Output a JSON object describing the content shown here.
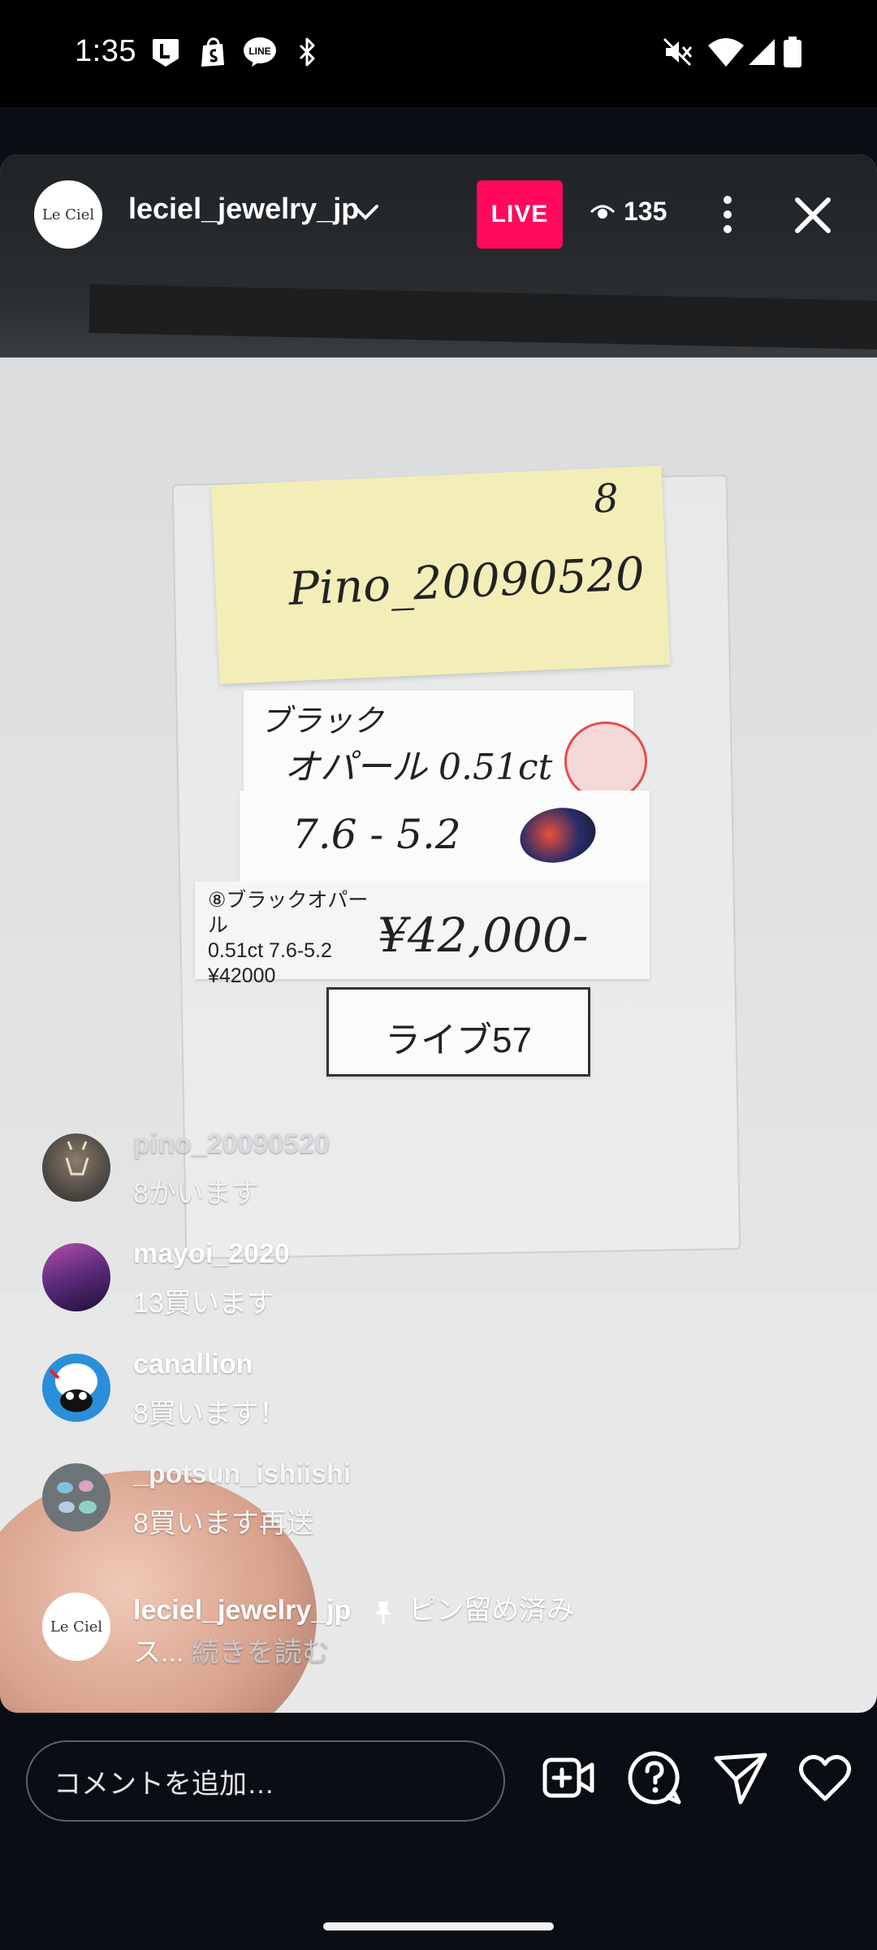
{
  "status_bar": {
    "time": "1:35",
    "icons": [
      "line-l-icon",
      "shopify-icon",
      "line-chat-icon",
      "bluetooth-icon",
      "mute-icon",
      "wifi-icon",
      "signal-icon",
      "battery-icon"
    ]
  },
  "header": {
    "username": "leciel_jewelry_jp",
    "avatar_text": "Le Ciel",
    "live_label": "LIVE",
    "viewer_count": "135"
  },
  "video_content": {
    "note_number": "8",
    "note_name": "Pino_20090520",
    "card_line1": "ブラック",
    "card_line2": "オパール 0.51ct",
    "card_size": "7.6 - 5.2",
    "tag_line1": "⑧ブラックオパール",
    "tag_line2": "0.51ct 7.6-5.2",
    "tag_line3": "¥42000",
    "price_hand": "¥42,000-",
    "live_label_card": "ライブ57"
  },
  "comments": [
    {
      "user": "pino_20090520",
      "text": "8かいます"
    },
    {
      "user": "mayoi_2020",
      "text": "13買います"
    },
    {
      "user": "canallion",
      "text": "8買います！"
    },
    {
      "user": "_potsun_ishiishi",
      "text": "8買います再送"
    }
  ],
  "pinned": {
    "user": "leciel_jewelry_jp",
    "pin_label": "ピン留め済み",
    "text_start": "ス...",
    "read_more": "続きを読む",
    "avatar_text": "Le Ciel"
  },
  "bottom_bar": {
    "comment_placeholder": "コメントを追加…",
    "icons": [
      "add-video-icon",
      "question-icon",
      "send-icon",
      "heart-icon"
    ]
  },
  "colors": {
    "live_badge": "#ff0a5b",
    "background": "#0a0d14"
  }
}
